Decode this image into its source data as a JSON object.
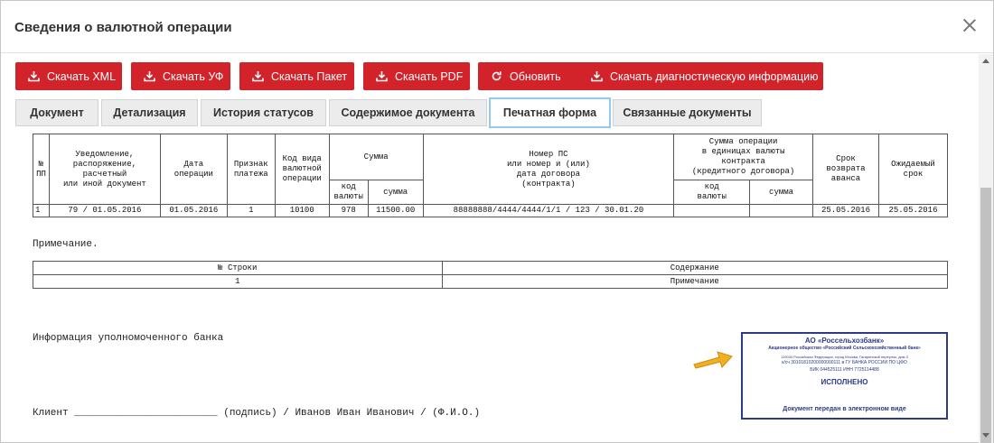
{
  "window": {
    "title": "Сведения о валютной операции"
  },
  "toolbar": {
    "buttons": [
      {
        "label": "Скачать XML",
        "icon": "download-icon"
      },
      {
        "label": "Скачать УФ",
        "icon": "download-icon"
      },
      {
        "label": "Скачать Пакет",
        "icon": "download-icon"
      },
      {
        "label": "Скачать PDF",
        "icon": "download-icon"
      },
      {
        "label": "Обновить",
        "icon": "refresh-icon"
      },
      {
        "label": "Скачать диагностическую информацию",
        "icon": "download-icon"
      }
    ]
  },
  "tabs": [
    {
      "label": "Документ",
      "active": false
    },
    {
      "label": "Детализация",
      "active": false
    },
    {
      "label": "История статусов",
      "active": false
    },
    {
      "label": "Содержимое документа",
      "active": false
    },
    {
      "label": "Печатная форма",
      "active": true
    },
    {
      "label": "Связанные документы",
      "active": false
    }
  ],
  "main_table": {
    "headers": {
      "num": "№\nПП",
      "notice": "Уведомление,\nраспоряжение,\nрасчетный\nили иной документ",
      "date": "Дата\nоперации",
      "sign": "Признак\nплатежа",
      "code": "Код вида\nвалютной\nоперации",
      "sum": "Сумма",
      "sum_code": "код\nвалюты",
      "sum_amount": "сумма",
      "ps": "Номер ПС\nили номер и (или)\nдата договора\n(контракта)",
      "contract_sum": "Сумма операции\nв единицах валюты\nконтракта\n(кредитного договора)",
      "contract_code": "код\nвалюты",
      "contract_amount": "сумма",
      "advance_term": "Срок\nвозврата\nаванса",
      "expected_term": "Ожидаемый\nсрок"
    },
    "row": {
      "num": "1",
      "notice": "79 / 01.05.2016",
      "date": "01.05.2016",
      "sign": "1",
      "code": "10100",
      "sum_code": "978",
      "sum_amount": "11500.00",
      "ps": "88888888/4444/4444/1/1 / 123 / 30.01.20",
      "contract_code": "",
      "contract_amount": "",
      "advance_term": "25.05.2016",
      "expected_term": "25.05.2016"
    }
  },
  "note": {
    "label": "Примечание.",
    "headers": {
      "row_num": "№ Строки",
      "content": "Содержание"
    },
    "row": {
      "row_num": "1",
      "content": "Примечание"
    }
  },
  "bank_info": {
    "label": "Информация уполномоченного банка"
  },
  "client_line": "Клиент ________________________ (подпись) / Иванов Иван Иванович / (Ф.И.О.)",
  "stamp": {
    "name": "АО «Россельхозбанк»",
    "full_name": "Акционерное общество «Российский Сельскохозяйственный банк»",
    "address": "119034 Российская Федерация, город Москва, Гагаринский переулок, дом 3",
    "account": "к/сч 30101810200000000111 в ГУ БАНКА РОССИИ ПО ЦФО",
    "bik": "БИК 044525111 ИНН 7725114488",
    "status": "ИСПОЛНЕНО",
    "footer": "Документ передан в электронном виде",
    "color": "#2d3a85"
  },
  "colors": {
    "accent": "#d2232a",
    "active_tab_border": "#93c9ef",
    "arrow": "#f2b020"
  }
}
